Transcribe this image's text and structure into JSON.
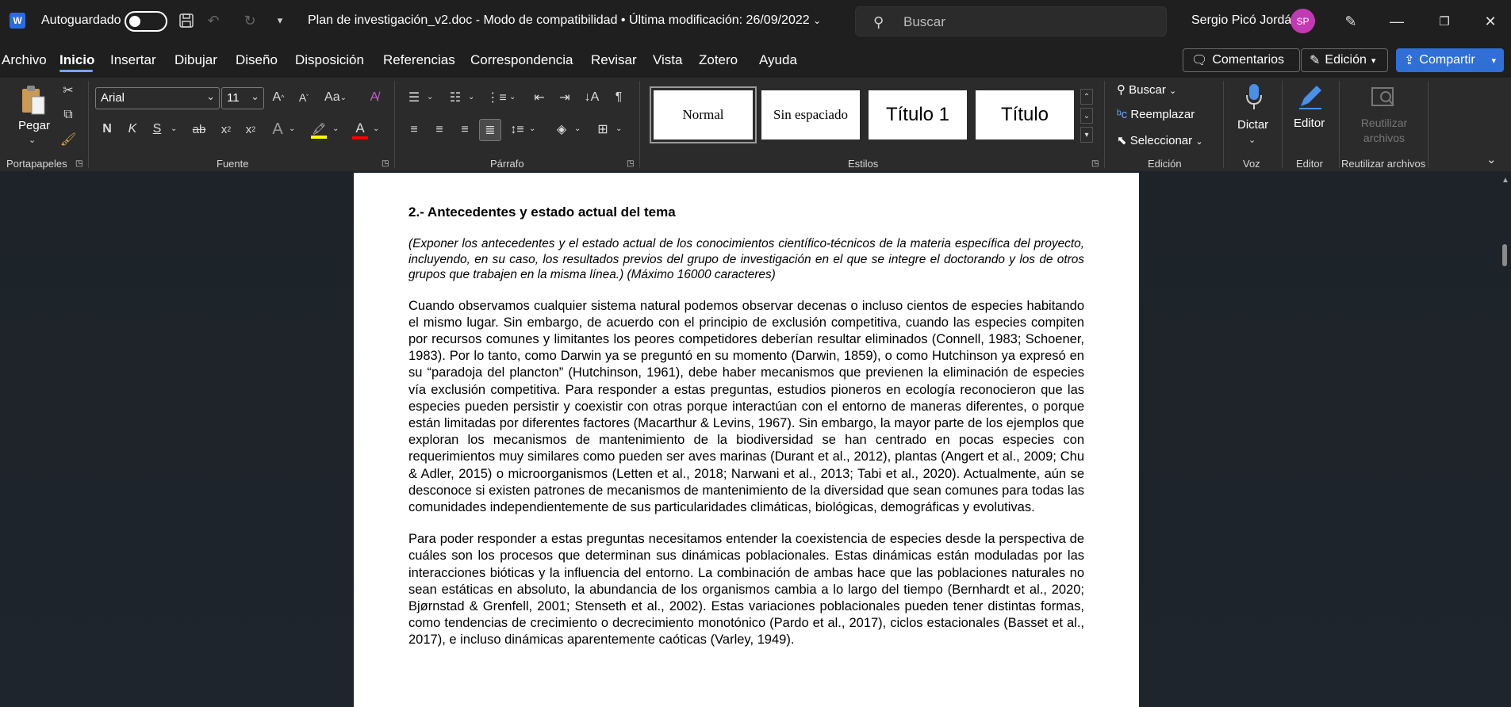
{
  "titlebar": {
    "autosave_label": "Autoguardado",
    "document_title": "Plan de investigación_v2.doc  -  Modo de compatibilidad  •  Última modificación: 26/09/2022",
    "search_placeholder": "Buscar",
    "user_name": "Sergio Picó Jordá",
    "user_initials": "SP",
    "app_logo": "W"
  },
  "tabs": [
    "Archivo",
    "Inicio",
    "Insertar",
    "Dibujar",
    "Diseño",
    "Disposición",
    "Referencias",
    "Correspondencia",
    "Revisar",
    "Vista",
    "Zotero",
    "Ayuda"
  ],
  "actions": {
    "comments": "Comentarios",
    "editing": "Edición",
    "share": "Compartir"
  },
  "ribbon": {
    "clipboard": {
      "paste": "Pegar",
      "label": "Portapapeles"
    },
    "font": {
      "name": "Arial",
      "size": "11",
      "label": "Fuente",
      "bold": "N",
      "italic": "K",
      "underline": "S",
      "strike": "ab"
    },
    "paragraph": {
      "label": "Párrafo"
    },
    "styles": {
      "items": [
        "Normal",
        "Sin espaciado",
        "Título 1",
        "Título"
      ],
      "label": "Estilos"
    },
    "editing": {
      "find": "Buscar",
      "replace": "Reemplazar",
      "select": "Seleccionar",
      "label": "Edición"
    },
    "voice": {
      "dictate": "Dictar",
      "label": "Voz"
    },
    "editor": {
      "editor": "Editor",
      "label": "Editor"
    },
    "reuse": {
      "reuse": "Reutilizar archivos",
      "label": "Reutilizar archivos"
    }
  },
  "colors": {
    "highlight": "#ffff00",
    "font_color": "#ff0000",
    "accent": "#2f6fd6",
    "avatar": "#c239b3"
  },
  "document": {
    "heading": "2.- Antecedentes y estado actual del tema",
    "instructions": "(Exponer los antecedentes y el estado actual de los conocimientos científico-técnicos de la materia específica del proyecto, incluyendo, en su caso, los resultados previos del grupo de investigación en el que se integre el doctorando y los de otros grupos que trabajen en la misma línea.) (Máximo 16000 caracteres)",
    "paragraph1": "Cuando observamos cualquier sistema natural podemos observar decenas o incluso cientos de especies habitando el mismo lugar. Sin embargo, de acuerdo con el principio de exclusión competitiva, cuando las especies compiten por recursos comunes y limitantes los peores competidores deberían resultar eliminados (Connell, 1983; Schoener, 1983). Por lo tanto, como Darwin ya se preguntó en su momento (Darwin, 1859), o como Hutchinson ya expresó en su “paradoja del plancton” (Hutchinson, 1961), debe haber mecanismos que previenen la eliminación de especies vía exclusión competitiva. Para responder a estas preguntas, estudios pioneros en ecología reconocieron que las especies pueden persistir y coexistir con otras porque interactúan con el entorno de maneras diferentes, o porque están limitadas por diferentes factores (Macarthur & Levins, 1967). Sin embargo, la mayor parte de los ejemplos que exploran los mecanismos de mantenimiento de la biodiversidad se han centrado en pocas especies con requerimientos muy similares como pueden ser aves marinas (Durant et al., 2012), plantas (Angert et al., 2009; Chu & Adler, 2015) o microorganismos (Letten et al., 2018; Narwani et al., 2013; Tabi et al., 2020). Actualmente, aún se desconoce si existen patrones de mecanismos de mantenimiento de la diversidad que sean comunes para todas las comunidades independientemente de sus particularidades climáticas, biológicas, demográficas y evolutivas.",
    "paragraph2": "Para poder responder a estas preguntas necesitamos entender la coexistencia de especies desde la perspectiva de cuáles son los procesos que determinan sus dinámicas poblacionales. Estas dinámicas están moduladas por las interacciones bióticas y la influencia del entorno. La combinación de ambas hace que las poblaciones naturales no sean estáticas en absoluto, la abundancia de los organismos cambia a lo largo del tiempo (Bernhardt et al., 2020; Bjørnstad & Grenfell, 2001; Stenseth et al., 2002). Estas variaciones poblacionales pueden tener distintas formas, como tendencias de crecimiento o decrecimiento monotónico (Pardo et al., 2017), ciclos estacionales (Basset et al., 2017), e incluso dinámicas aparentemente caóticas (Varley, 1949)."
  }
}
